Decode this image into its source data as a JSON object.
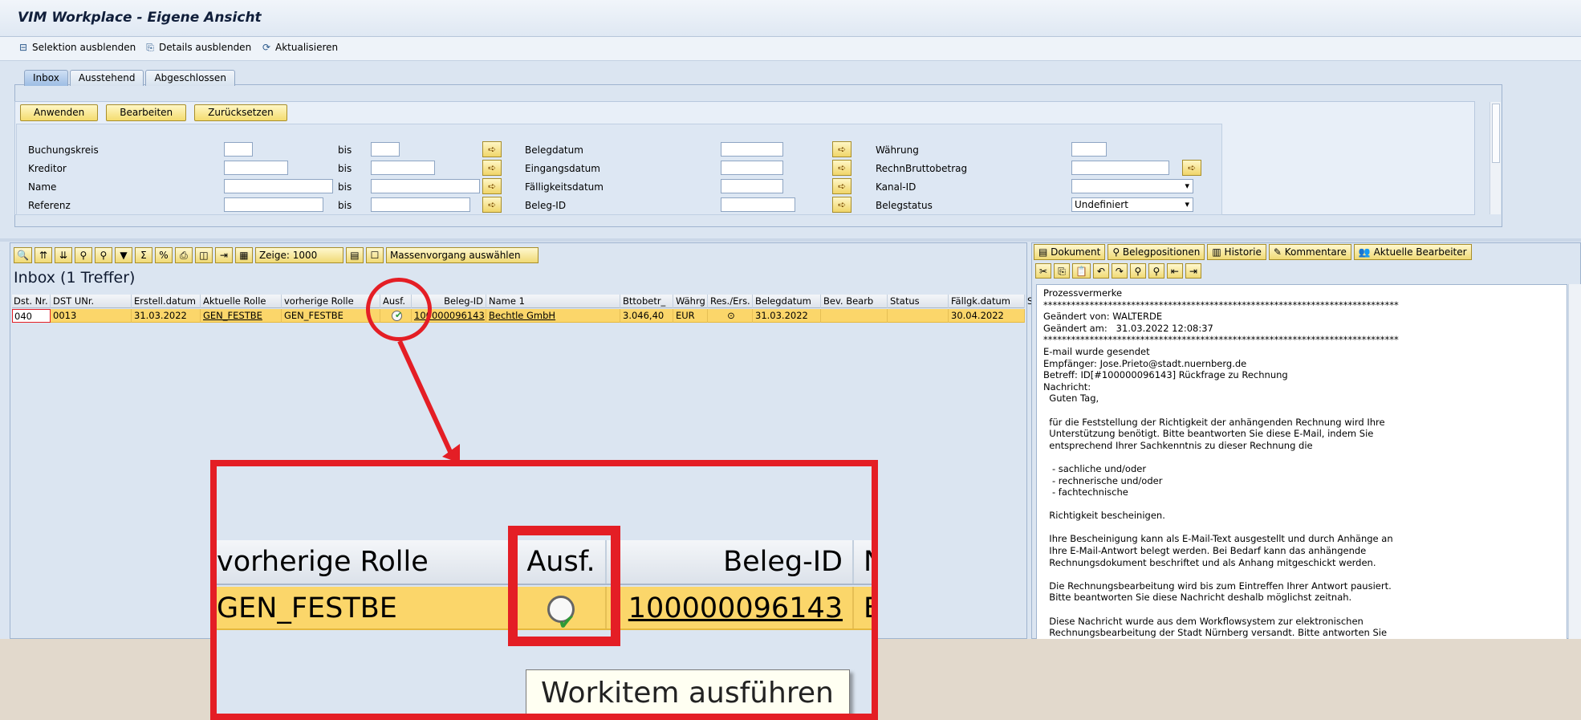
{
  "window": {
    "title": "VIM Workplace - Eigene Ansicht"
  },
  "toolbar": {
    "selection_hide": "Selektion ausblenden",
    "details_hide": "Details ausblenden",
    "refresh": "Aktualisieren"
  },
  "tabs": [
    "Inbox",
    "Ausstehend",
    "Abgeschlossen"
  ],
  "buttons": {
    "apply": "Anwenden",
    "edit": "Bearbeiten",
    "reset": "Zurücksetzen"
  },
  "bis": "bis",
  "fields": {
    "buchungskreis": "Buchungskreis",
    "kreditor": "Kreditor",
    "name": "Name",
    "referenz": "Referenz",
    "belegdatum": "Belegdatum",
    "eingangsdatum": "Eingangsdatum",
    "faelligkeitsdatum": "Fälligkeitsdatum",
    "beleg_id": "Beleg-ID",
    "waehrung": "Währung",
    "rechn_brutto": "RechnBruttobetrag",
    "kanal_id": "Kanal-ID",
    "belegstatus": "Belegstatus",
    "belegstatus_value": "Undefiniert"
  },
  "grid": {
    "show_label": "Zeige: 1000",
    "mass_select": "Massenvorgang auswählen",
    "title": "Inbox (1  Treffer)",
    "columns": [
      "Dst. Nr.",
      "DST UNr.",
      "Erstell.datum",
      "Aktuelle Rolle",
      "vorherige Rolle",
      "Ausf.",
      "Beleg-ID",
      "Name 1",
      "Bttobetr_",
      "Währg",
      "Res./Ers.",
      "Belegdatum",
      "Bev. Bearb",
      "Status",
      "Fällgk.datum",
      "S"
    ],
    "row": {
      "dst_nr": "040",
      "dst_unr": "0013",
      "erstell_datum": "31.03.2022",
      "aktuelle_rolle": "GEN_FESTBE",
      "vorherige_rolle": "GEN_FESTBE",
      "beleg_id": "100000096143",
      "name1": "Bechtle GmbH",
      "betrag": "3.046,40",
      "waehrung": "EUR",
      "belegdatum": "31.03.2022",
      "faelligkeit": "30.04.2022"
    }
  },
  "right_tabs": [
    "Dokument",
    "Belegpositionen",
    "Historie",
    "Kommentare",
    "Aktuelle Bearbeiter"
  ],
  "notes": {
    "text": "Prozessvermerke\n*****************************************************************************\nGeändert von: WALTERDE\nGeändert am:   31.03.2022 12:08:37\n*****************************************************************************\nE-mail wurde gesendet\nEmpfänger: Jose.Prieto@stadt.nuernberg.de\nBetreff: ID[#100000096143] Rückfrage zu Rechnung\nNachricht:\n  Guten Tag,\n\n  für die Feststellung der Richtigkeit der anhängenden Rechnung wird Ihre\n  Unterstützung benötigt. Bitte beantworten Sie diese E-Mail, indem Sie\n  entsprechend Ihrer Sachkenntnis zu dieser Rechnung die\n\n   - sachliche und/oder\n   - rechnerische und/oder\n   - fachtechnische\n\n  Richtigkeit bescheinigen.\n\n  Ihre Bescheinigung kann als E-Mail-Text ausgestellt und durch Anhänge an\n  Ihre E-Mail-Antwort belegt werden. Bei Bedarf kann das anhängende\n  Rechnungsdokument beschriftet und als Anhang mitgeschickt werden.\n\n  Die Rechnungsbearbeitung wird bis zum Eintreffen Ihrer Antwort pausiert.\n  Bitte beantworten Sie diese Nachricht deshalb möglichst zeitnah.\n\n  Diese Nachricht wurde aus dem Workflowsystem zur elektronischen\n  Rechnungsbearbeitung der Stadt Nürnberg versandt. Bitte antworten Sie"
  },
  "zoom": {
    "col_prev_role": "vorherige Rolle",
    "col_ausf": "Ausf.",
    "col_beleg_id": "Beleg-ID",
    "col_next_partial": "N",
    "prev_role_value": "GEN_FESTBE",
    "beleg_id_value": "100000096143",
    "next_partial_value": "E",
    "tooltip": "Workitem ausführen"
  },
  "colors": {
    "highlight": "#e41e25",
    "row_selected": "#fbd66a",
    "background": "#dbe5f1"
  }
}
